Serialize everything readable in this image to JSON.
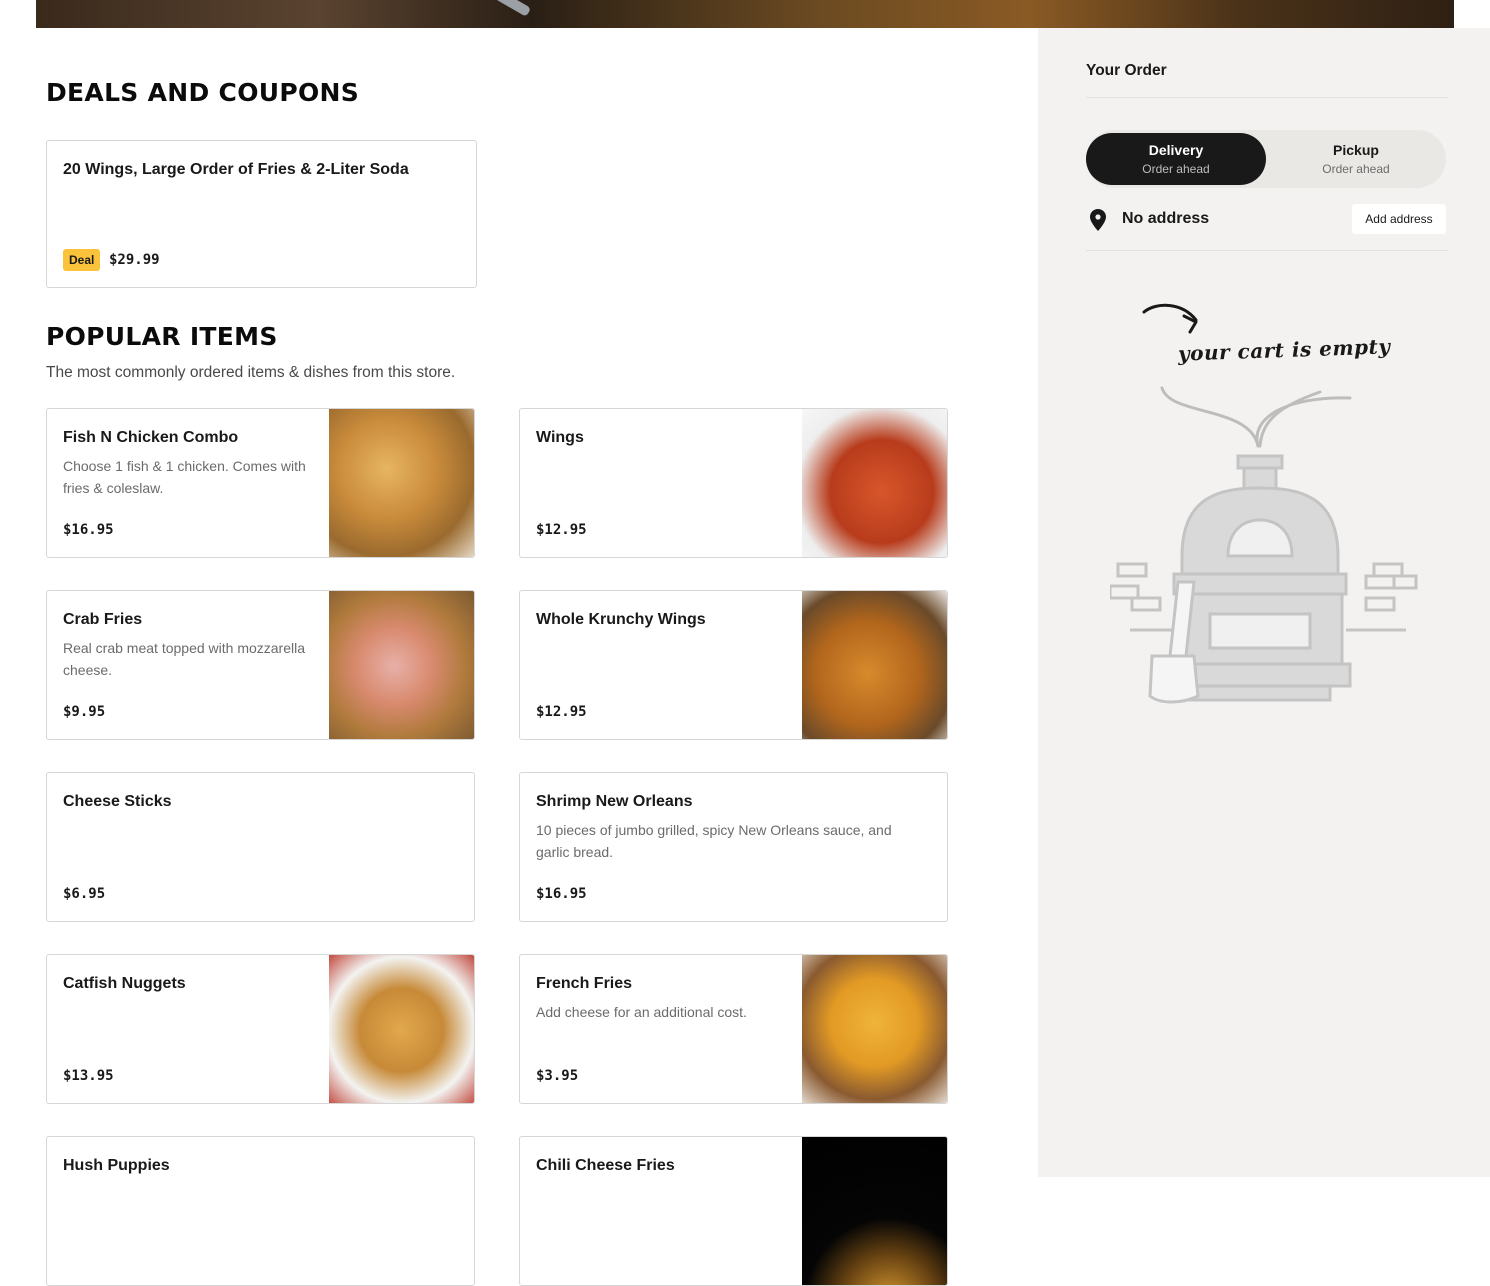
{
  "deals": {
    "title": "DEALS AND COUPONS",
    "items": [
      {
        "name": "20 Wings, Large Order of Fries & 2-Liter Soda",
        "badge": "Deal",
        "price": "$29.99"
      }
    ]
  },
  "popular": {
    "title": "POPULAR ITEMS",
    "subtitle": "The most commonly ordered items & dishes from this store.",
    "items": [
      {
        "name": "Fish N Chicken Combo",
        "description": "Choose 1 fish & 1 chicken. Comes with fries & coleslaw.",
        "price": "$16.95"
      },
      {
        "name": "Wings",
        "description": "",
        "price": "$12.95"
      },
      {
        "name": "Crab Fries",
        "description": "Real crab meat topped with mozzarella cheese.",
        "price": "$9.95"
      },
      {
        "name": "Whole Krunchy Wings",
        "description": "",
        "price": "$12.95"
      },
      {
        "name": "Cheese Sticks",
        "description": "",
        "price": "$6.95"
      },
      {
        "name": "Shrimp New Orleans",
        "description": "10 pieces of jumbo grilled, spicy New Orleans sauce, and garlic bread.",
        "price": "$16.95"
      },
      {
        "name": "Catfish Nuggets",
        "description": "",
        "price": "$13.95"
      },
      {
        "name": "French Fries",
        "description": "Add cheese for an additional cost.",
        "price": "$3.95"
      },
      {
        "name": "Hush Puppies",
        "description": "",
        "price": ""
      },
      {
        "name": "Chili Cheese Fries",
        "description": "",
        "price": ""
      }
    ]
  },
  "order": {
    "title": "Your Order",
    "delivery_label": "Delivery",
    "delivery_sub": "Order ahead",
    "pickup_label": "Pickup",
    "pickup_sub": "Order ahead",
    "address_text": "No address",
    "add_address_label": "Add address",
    "empty_text": "your cart is empty"
  },
  "icons": {
    "address": "map-pin-icon",
    "empty_cart": "pizza-oven-illustration"
  },
  "colors": {
    "deal_badge": "#fbc33c",
    "toggle_active": "#191919",
    "sidebar_bg": "#f3f2f0"
  }
}
